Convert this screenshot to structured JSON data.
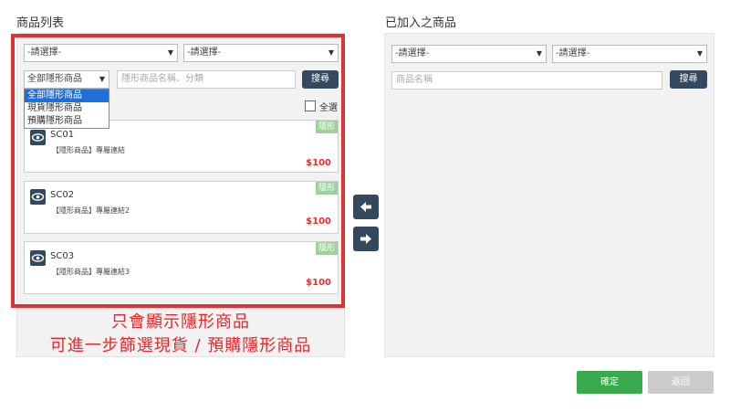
{
  "left": {
    "title": "商品列表",
    "select1": "-請選擇-",
    "select2": "-請選擇-",
    "type_select": "全部隱形商品",
    "search_placeholder": "隱形商品名稱．分類",
    "search_button": "搜尋",
    "dropdown_options": [
      "全部隱形商品",
      "現貨隱形商品",
      "預購隱形商品"
    ],
    "select_all": "全選",
    "products": [
      {
        "tag": "隱形",
        "code": "SC01",
        "desc": "【隱形商品】專屬連結",
        "price": "$100"
      },
      {
        "tag": "隱形",
        "code": "SC02",
        "desc": "【隱形商品】專屬連結2",
        "price": "$100"
      },
      {
        "tag": "隱形",
        "code": "SC03",
        "desc": "【隱形商品】專屬連結3",
        "price": "$100"
      }
    ]
  },
  "right": {
    "title": "已加入之商品",
    "select1": "-請選擇-",
    "select2": "-請選擇-",
    "search_placeholder": "商品名稱",
    "search_button": "搜尋"
  },
  "annotation": {
    "line1": "只會顯示隱形商品",
    "line2": "可進一步篩選現貨 / 預購隱形商品"
  },
  "footer": {
    "confirm": "確定",
    "back": "返回"
  },
  "icons": {
    "move_left": "arrow-left-icon",
    "move_right": "arrow-right-icon",
    "preview": "eye-icon"
  },
  "colors": {
    "dark_button": "#34495e",
    "price": "#e03030",
    "tag": "#9fd19b",
    "highlight": "#dd3333",
    "confirm": "#3aa84d"
  }
}
